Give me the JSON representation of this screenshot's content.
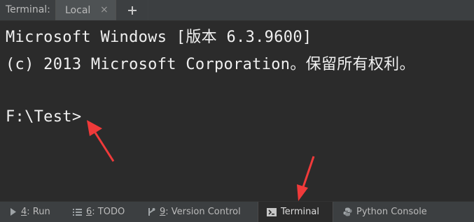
{
  "header": {
    "panel_label": "Terminal:",
    "tab": {
      "label": "Local",
      "close_glyph": "×"
    },
    "add_glyph": "+"
  },
  "terminal": {
    "lines": [
      "Microsoft Windows [版本 6.3.9600]",
      "(c) 2013 Microsoft Corporation。保留所有权利。",
      "",
      "F:\\Test>"
    ]
  },
  "bottom_bar": {
    "items": [
      {
        "mnemonic": "4",
        "rest": ": Run",
        "icon": "play-icon"
      },
      {
        "mnemonic": "6",
        "rest": ": TODO",
        "icon": "todo-list-icon"
      },
      {
        "mnemonic": "9",
        "rest": ": Version Control",
        "icon": "version-control-icon"
      },
      {
        "mnemonic": "",
        "rest": "Terminal",
        "icon": "terminal-icon",
        "active": true
      },
      {
        "mnemonic": "",
        "rest": "Python Console",
        "icon": "python-icon"
      }
    ]
  },
  "colors": {
    "background": "#2b2b2b",
    "toolbar": "#3c3f41",
    "text": "#f0f0f0",
    "annotation_arrow": "#f03a3a"
  }
}
